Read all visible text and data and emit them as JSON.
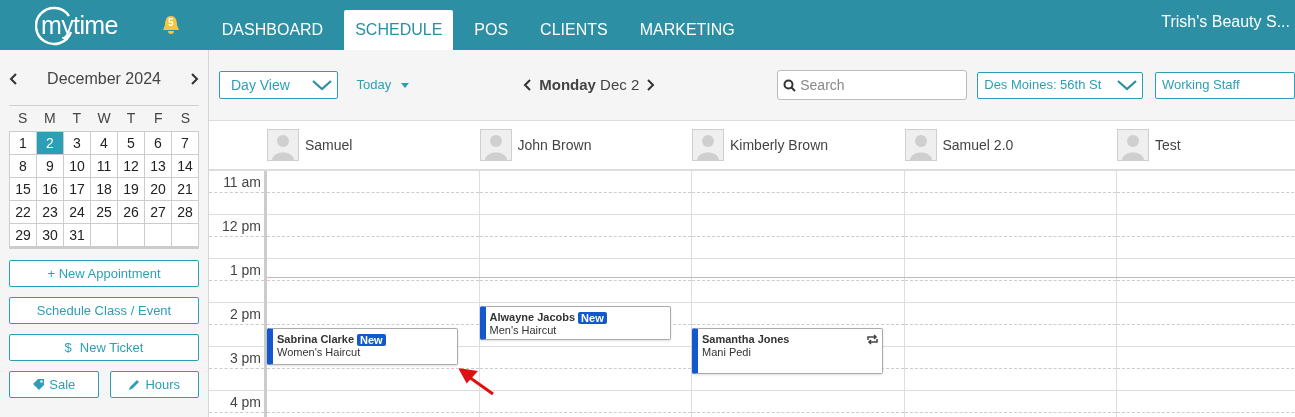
{
  "topbar": {
    "logo": "mytime",
    "notifications": "5",
    "tabs": [
      {
        "label": "DASHBOARD",
        "selected": false
      },
      {
        "label": "SCHEDULE",
        "selected": true
      },
      {
        "label": "POS",
        "selected": false
      },
      {
        "label": "CLIENTS",
        "selected": false
      },
      {
        "label": "MARKETING",
        "selected": false
      }
    ],
    "business": "Trish's Beauty S..."
  },
  "sidebar": {
    "month": "December 2024",
    "weekdays": [
      "S",
      "M",
      "T",
      "W",
      "T",
      "F",
      "S"
    ],
    "days": [
      {
        "label": "1",
        "selected": false
      },
      {
        "label": "2",
        "selected": true
      },
      {
        "label": "3",
        "selected": false
      },
      {
        "label": "4",
        "selected": false
      },
      {
        "label": "5",
        "selected": false
      },
      {
        "label": "6",
        "selected": false
      },
      {
        "label": "7",
        "selected": false
      },
      {
        "label": "8",
        "selected": false
      },
      {
        "label": "9",
        "selected": false
      },
      {
        "label": "10",
        "selected": false
      },
      {
        "label": "11",
        "selected": false
      },
      {
        "label": "12",
        "selected": false
      },
      {
        "label": "13",
        "selected": false
      },
      {
        "label": "14",
        "selected": false
      },
      {
        "label": "15",
        "selected": false
      },
      {
        "label": "16",
        "selected": false
      },
      {
        "label": "17",
        "selected": false
      },
      {
        "label": "18",
        "selected": false
      },
      {
        "label": "19",
        "selected": false
      },
      {
        "label": "20",
        "selected": false
      },
      {
        "label": "21",
        "selected": false
      },
      {
        "label": "22",
        "selected": false
      },
      {
        "label": "23",
        "selected": false
      },
      {
        "label": "24",
        "selected": false
      },
      {
        "label": "25",
        "selected": false
      },
      {
        "label": "26",
        "selected": false
      },
      {
        "label": "27",
        "selected": false
      },
      {
        "label": "28",
        "selected": false
      },
      {
        "label": "29",
        "selected": false
      },
      {
        "label": "30",
        "selected": false
      },
      {
        "label": "31",
        "selected": false
      }
    ],
    "buttons": [
      {
        "label": "+ New Appointment",
        "kind": "plain"
      },
      {
        "label": "Schedule Class / Event",
        "kind": "plain"
      },
      {
        "label": "New Ticket",
        "kind": "dollar",
        "icon": "$"
      }
    ],
    "small_buttons": [
      {
        "label": "Sale",
        "kind": "tag"
      },
      {
        "label": "Hours",
        "kind": "pencil"
      }
    ]
  },
  "toolbar": {
    "view": "Day View",
    "today": "Today",
    "date_day": "Monday",
    "date_rest": "Dec 2",
    "search": {
      "placeholder": "Search"
    },
    "location": "Des Moines: 56th St",
    "staff_filter": "Working Staff"
  },
  "times": [
    "11 am",
    "12 pm",
    "1 pm",
    "2 pm",
    "3 pm",
    "4 pm"
  ],
  "staff": [
    {
      "name": "Samuel",
      "appointments": [
        {
          "client": "Sabrina Clarke",
          "service": "Women's Haircut",
          "badge": "New",
          "repeat": false
        }
      ]
    },
    {
      "name": "John Brown",
      "appointments": [
        {
          "client": "Alwayne Jacobs",
          "service": "Men's Haircut",
          "badge": "New",
          "repeat": false
        }
      ]
    },
    {
      "name": "Kimberly Brown",
      "appointments": [
        {
          "client": "Samantha Jones",
          "service": "Mani Pedi",
          "repeat": true
        }
      ]
    },
    {
      "name": "Samuel 2.0"
    },
    {
      "name": "Test"
    }
  ]
}
